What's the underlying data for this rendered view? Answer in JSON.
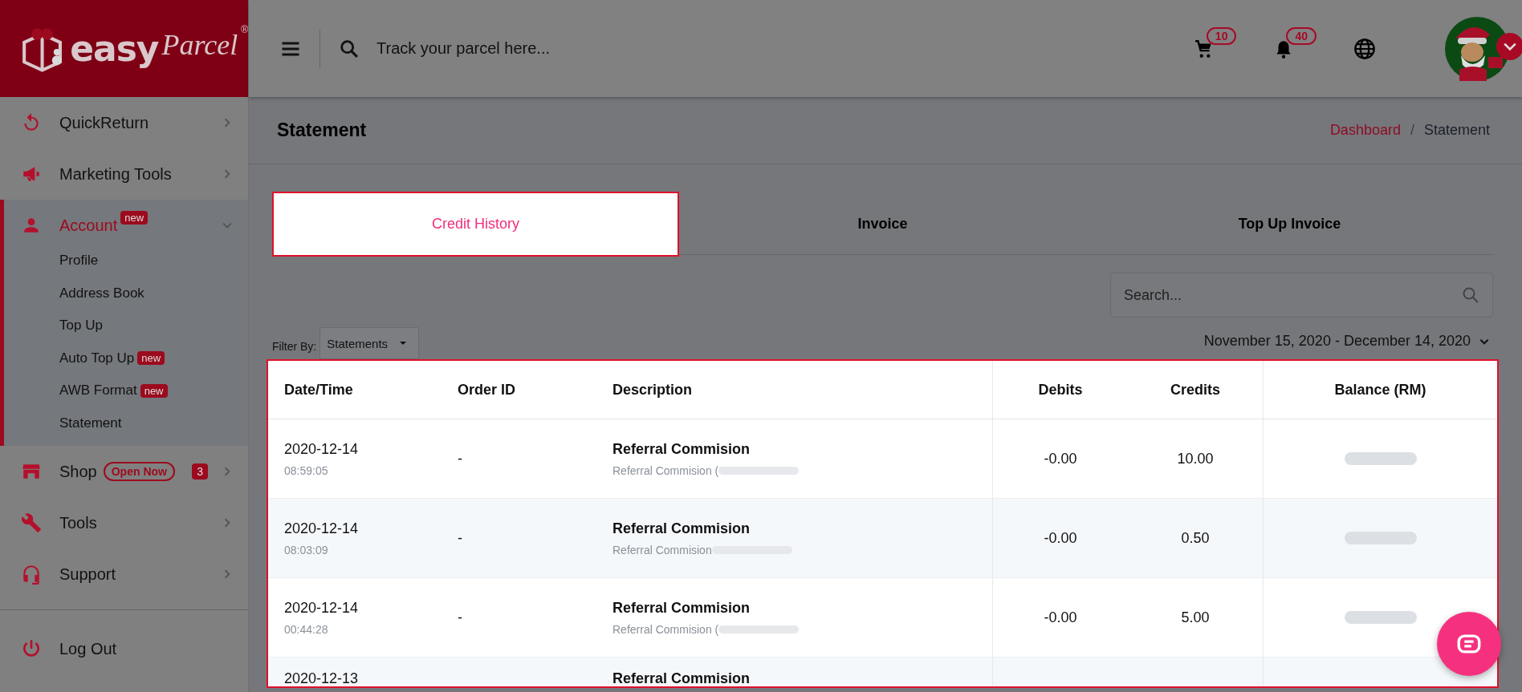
{
  "logo": {
    "word1": "easy",
    "word2": "Parcel",
    "mark": "®"
  },
  "header": {
    "search_placeholder": "Track your parcel here...",
    "cart_count": "10",
    "notification_count": "40"
  },
  "sidebar": {
    "items": [
      {
        "label": "QuickReturn",
        "selected": false,
        "expanded": false
      },
      {
        "label": "Marketing Tools",
        "selected": false,
        "expanded": false
      },
      {
        "label": "Account",
        "badge": "new",
        "selected": true,
        "expanded": true,
        "children": [
          {
            "label": "Profile"
          },
          {
            "label": "Address Book"
          },
          {
            "label": "Top Up"
          },
          {
            "label": "Auto Top Up",
            "badge": "new"
          },
          {
            "label": "AWB Format",
            "badge": "new"
          },
          {
            "label": "Statement"
          }
        ]
      },
      {
        "label": "Shop",
        "tag": "Open Now",
        "count": "3",
        "selected": false,
        "expanded": false
      },
      {
        "label": "Tools",
        "selected": false,
        "expanded": false
      },
      {
        "label": "Support",
        "selected": false,
        "expanded": false
      }
    ],
    "logout": "Log Out"
  },
  "page": {
    "title": "Statement",
    "breadcrumb_separator": "/",
    "breadcrumb": [
      {
        "label": "Dashboard",
        "kind": "link"
      },
      {
        "label": "Statement",
        "kind": "current"
      }
    ]
  },
  "tabs": [
    {
      "label": "Credit History",
      "selected": true
    },
    {
      "label": "Invoice",
      "selected": false
    },
    {
      "label": "Top Up Invoice",
      "selected": false
    }
  ],
  "search": {
    "placeholder": "Search..."
  },
  "filter": {
    "label": "Filter By:",
    "value": "Statements"
  },
  "date_range": "November 15, 2020 - December 14, 2020",
  "table": {
    "columns": [
      "Date/Time",
      "Order ID",
      "Description",
      "Debits",
      "Credits",
      "Balance (RM)"
    ],
    "rows": [
      {
        "date": "2020-12-14",
        "time": "08:59:05",
        "order_id": "-",
        "description": "Referral Commision",
        "detail": "Referral Commision (",
        "debits": "-0.00",
        "credits": "10.00"
      },
      {
        "date": "2020-12-14",
        "time": "08:03:09",
        "order_id": "-",
        "description": "Referral Commision",
        "detail": "Referral Commision",
        "debits": "-0.00",
        "credits": "0.50"
      },
      {
        "date": "2020-12-14",
        "time": "00:44:28",
        "order_id": "-",
        "description": "Referral Commision",
        "detail": "Referral Commision (",
        "debits": "-0.00",
        "credits": "5.00"
      },
      {
        "date": "2020-12-13",
        "description": "Referral Commision"
      }
    ]
  }
}
